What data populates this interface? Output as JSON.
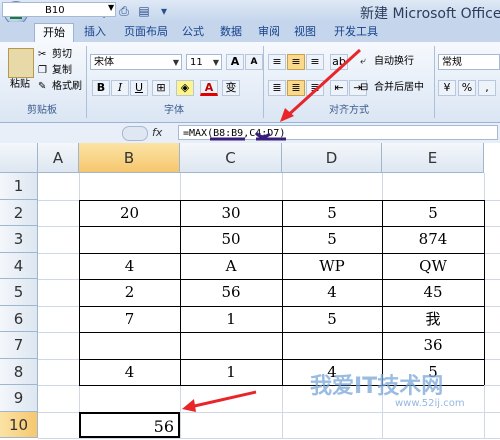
{
  "window": {
    "title": "新建 Microsoft Office"
  },
  "quick_access": [
    "save-icon",
    "undo-icon",
    "redo-icon",
    "print-icon",
    "preview-icon",
    "dropdown-icon"
  ],
  "tabs": [
    "开始",
    "插入",
    "页面布局",
    "公式",
    "数据",
    "审阅",
    "视图",
    "开发工具"
  ],
  "clipboard": {
    "paste": "粘贴",
    "cut": "剪切",
    "copy": "复制",
    "format_painter": "格式刷",
    "group_label": "剪贴板"
  },
  "font": {
    "name": "宋体",
    "size": "11",
    "grow": "A",
    "shrink": "A",
    "bold": "B",
    "italic": "I",
    "underline": "U",
    "font_color": "A",
    "group_label": "字体"
  },
  "alignment": {
    "wrap_text": "自动换行",
    "merge_center": "合并后居中",
    "group_label": "对齐方式"
  },
  "number": {
    "format": "常规"
  },
  "formula_bar": {
    "name_box": "B10",
    "fx": "fx",
    "formula": "=MAX(B8:B9,C4:D7)"
  },
  "grid": {
    "columns": [
      "A",
      "B",
      "C",
      "D",
      "E"
    ],
    "rows": [
      "1",
      "2",
      "3",
      "4",
      "5",
      "6",
      "7",
      "8",
      "9",
      "10"
    ],
    "cells": {
      "r2": [
        "",
        "20",
        "30",
        "5",
        "5"
      ],
      "r3": [
        "",
        "",
        "50",
        "5",
        "874"
      ],
      "r4": [
        "",
        "4",
        "A",
        "WP",
        "QW"
      ],
      "r5": [
        "",
        "2",
        "56",
        "4",
        "45"
      ],
      "r6": [
        "",
        "7",
        "1",
        "5",
        "我"
      ],
      "r7": [
        "",
        "",
        "",
        "",
        "36"
      ],
      "r8": [
        "",
        "4",
        "1",
        "4",
        "5"
      ],
      "b10": "56"
    }
  },
  "watermark": {
    "text": "我爱IT技术网",
    "url": "www.52ij.com"
  },
  "colors": {
    "selected_header": "#f6c76e",
    "annotation": "#e8262a",
    "underline_marks": "#3a1f7a"
  }
}
